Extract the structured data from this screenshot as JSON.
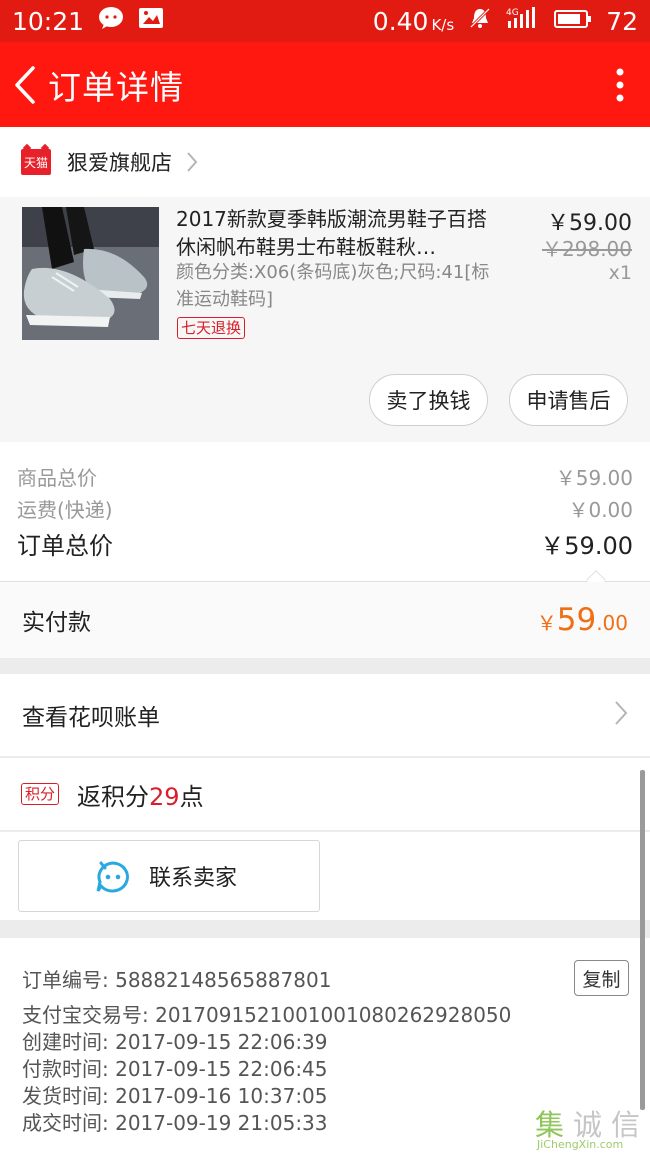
{
  "status_bar": {
    "time": "10:21",
    "net_speed": "0.40",
    "net_unit": "K/s",
    "network": "4G",
    "battery": "72"
  },
  "app_bar": {
    "title": "订单详情"
  },
  "shop": {
    "badge": "天猫",
    "name": "狠爱旗舰店"
  },
  "item": {
    "title": "2017新款夏季韩版潮流男鞋子百搭休闲帆布鞋男士布鞋板鞋秋…",
    "sku": "颜色分类:X06(条码底)灰色;尺码:41[标准运动鞋码]",
    "tag": "七天退换",
    "price": "￥59.00",
    "original_price": "￥298.00",
    "quantity": "x1",
    "buttons": {
      "exchange": "卖了换钱",
      "after_sale": "申请售后"
    }
  },
  "summary": {
    "goods_label": "商品总价",
    "goods_value": "￥59.00",
    "shipping_label": "运费(快递)",
    "shipping_value": "￥0.00",
    "order_total_label": "订单总价",
    "order_total_value": "￥59.00"
  },
  "payment": {
    "label": "实付款",
    "currency": "￥",
    "amount_int": "59",
    "amount_dec": ".00"
  },
  "huabei": {
    "label": "查看花呗账单"
  },
  "points": {
    "badge": "积分",
    "prefix": "返积分",
    "value": "29",
    "suffix": "点"
  },
  "contact": {
    "label": "联系卖家"
  },
  "order_info": {
    "order_no": "订单编号: 5888214856588780​1",
    "alipay_no": "支付宝交易号: 2017091521001001080262928050",
    "created": "创建时间: 2017-09-15  22:06:39",
    "paid": "付款时间: 2017-09-15  22:06:45",
    "shipped": "发货时间: 2017-09-16  10:37:05",
    "completed": "成交时间: 2017-09-19  21:05:33",
    "copy_label": "复制"
  },
  "watermark": {
    "chars": [
      "集",
      "诚",
      "信"
    ],
    "sub": "JiChengXin.com"
  },
  "colors": {
    "header_red": "#fe1810",
    "status_red": "#e21b12",
    "accent_red": "#d9202a",
    "pay_orange": "#f06e15",
    "contact_blue": "#2aa8e0"
  }
}
